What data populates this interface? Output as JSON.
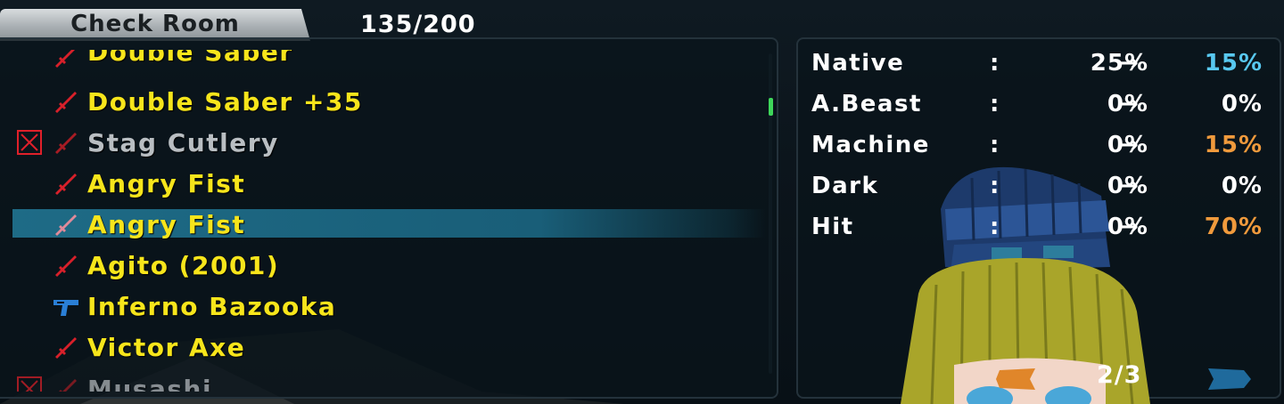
{
  "header": {
    "tab_label": "Check Room",
    "count": "135/200"
  },
  "items": [
    {
      "name": "Double Saber",
      "icon": "sword-icon",
      "state": "clipped-top"
    },
    {
      "name": "Double Saber +35",
      "icon": "sword-icon"
    },
    {
      "name": "Stag Cutlery",
      "icon": "sword-icon",
      "unusable": true
    },
    {
      "name": "Angry Fist",
      "icon": "sword-icon"
    },
    {
      "name": "Angry Fist",
      "icon": "sword-icon",
      "selected": true
    },
    {
      "name": "Agito (2001)",
      "icon": "sword-icon"
    },
    {
      "name": "Inferno Bazooka",
      "icon": "gun-icon"
    },
    {
      "name": "Victor Axe",
      "icon": "sword-icon"
    },
    {
      "name": "Musashi",
      "icon": "sword-icon",
      "unusable": true,
      "state": "clipped-bottom"
    }
  ],
  "stats": [
    {
      "name": "Native",
      "colon": ":",
      "old": "25%",
      "arrow": "→",
      "new": "15%",
      "new_color": "#58c8f0"
    },
    {
      "name": "A.Beast",
      "colon": ":",
      "old": "0%",
      "arrow": "→",
      "new": "0%",
      "new_color": "#ffffff"
    },
    {
      "name": "Machine",
      "colon": ":",
      "old": "0%",
      "arrow": "→",
      "new": "15%",
      "new_color": "#f09a3c"
    },
    {
      "name": "Dark",
      "colon": ":",
      "old": "0%",
      "arrow": "→",
      "new": "0%",
      "new_color": "#ffffff"
    },
    {
      "name": "Hit",
      "colon": ":",
      "old": "0%",
      "arrow": "→",
      "new": "70%",
      "new_color": "#f09a3c"
    }
  ],
  "pager": {
    "text": "2/3"
  },
  "colors": {
    "item_text": "#f7e51b",
    "unusable_text": "#b9bec2",
    "selection": "#1e6b86",
    "weapon_icon": "#d8202a",
    "gun_icon": "#2a7fd6",
    "scroll_thumb": "#3ed65a"
  }
}
